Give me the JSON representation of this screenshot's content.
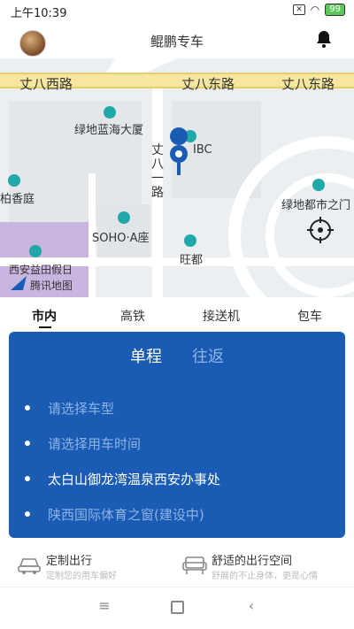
{
  "status": {
    "time": "上午10:39",
    "battery": "99"
  },
  "app": {
    "title": "鲲鹏专车"
  },
  "map": {
    "roads": [
      "丈八西路",
      "丈八东路",
      "丈八东路",
      "丈八一路"
    ],
    "pois": [
      "绿地蓝海大厦",
      "IBC",
      "柏香庭",
      "绿地都市之门",
      "SOHO·A座",
      "旺都",
      "西安益田假日"
    ],
    "attribution": "腾讯地图"
  },
  "tabs": [
    "市内",
    "高铁",
    "接送机",
    "包车"
  ],
  "trip": {
    "one_way": "单程",
    "round_trip": "往返",
    "car_type": "请选择车型",
    "time": "请选择用车时间",
    "from": "太白山御龙湾温泉西安办事处",
    "to": "陕西国际体育之窗(建设中)"
  },
  "features": [
    {
      "title": "定制出行",
      "subtitle": "定制您的用车偏好"
    },
    {
      "title": "舒适的出行空间",
      "subtitle": "舒展的不止身体，更是心情"
    }
  ],
  "colors": {
    "card": "#1a5bb3",
    "muted": "#8fb4e6",
    "map_bg": "#eceff2",
    "road": "#f5e6a0"
  }
}
